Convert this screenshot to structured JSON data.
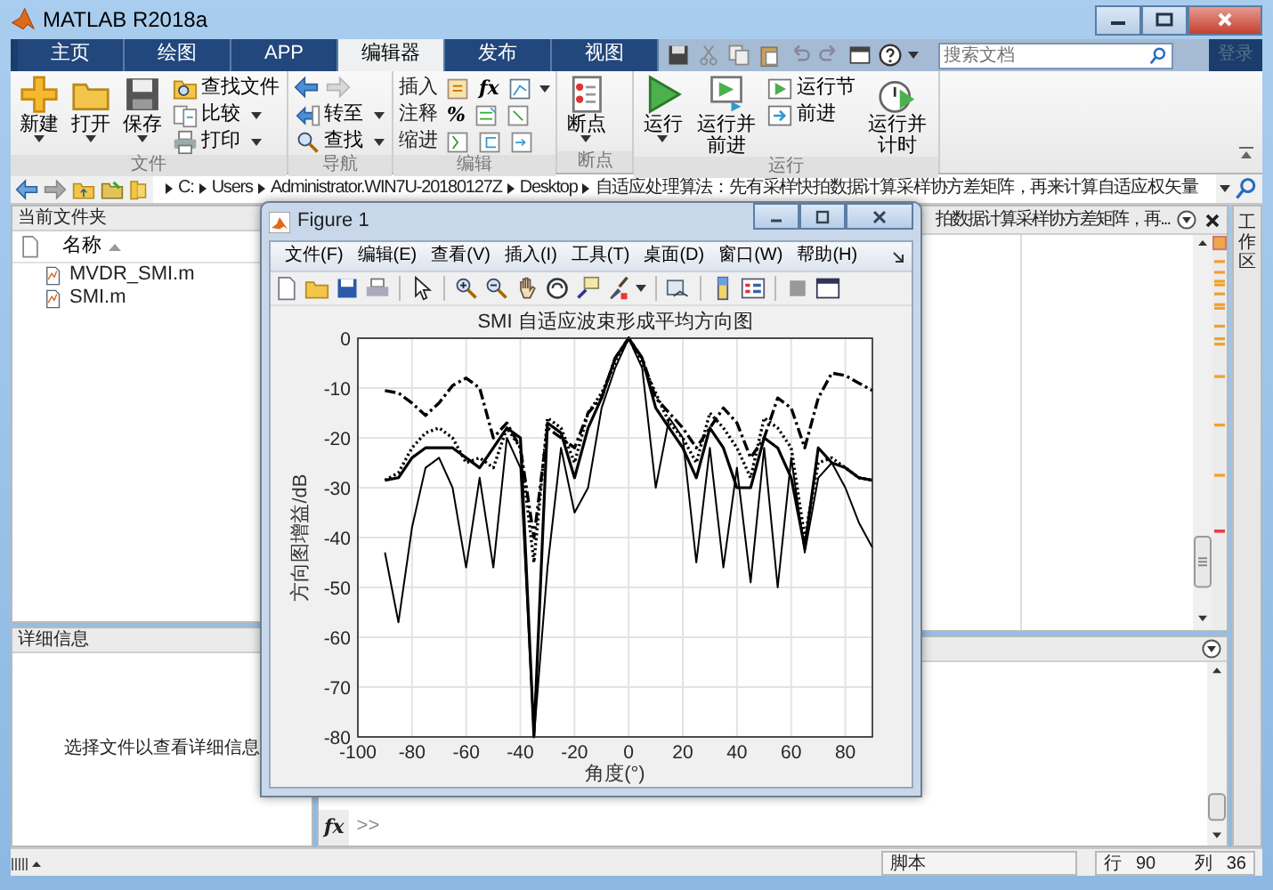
{
  "window": {
    "title": "MATLAB R2018a"
  },
  "tabs": [
    {
      "label": "主页",
      "selected": false
    },
    {
      "label": "绘图",
      "selected": false
    },
    {
      "label": "APP",
      "selected": false
    },
    {
      "label": "编辑器",
      "selected": true
    },
    {
      "label": "发布",
      "selected": false
    },
    {
      "label": "视图",
      "selected": false
    }
  ],
  "search": {
    "placeholder": "搜索文档"
  },
  "sign_in": "登录",
  "ribbon_groups": [
    {
      "label": "文件",
      "items": [
        {
          "kind": "large",
          "label": "新建",
          "dropdown": true
        },
        {
          "kind": "large",
          "label": "打开",
          "dropdown": true
        },
        {
          "kind": "large",
          "label": "保存",
          "dropdown": true
        },
        {
          "kind": "stack",
          "entries": [
            {
              "label": "查找文件",
              "dropdown": false
            },
            {
              "label": "比较",
              "dropdown": true
            },
            {
              "label": "打印",
              "dropdown": true
            }
          ]
        }
      ]
    },
    {
      "label": "导航",
      "items": [
        {
          "kind": "stack",
          "entries": [
            {
              "kind": "history",
              "forward_enabled": false
            },
            {
              "label": "转至",
              "dropdown": true
            },
            {
              "label": "查找",
              "dropdown": true
            }
          ]
        }
      ]
    },
    {
      "label": "编辑",
      "items": [
        {
          "kind": "tool_rows",
          "rows": [
            {
              "label": "插入",
              "tools": [
                {
                  "kind": "icon"
                },
                {
                  "kind": "glyph",
                  "text": "fx"
                },
                {
                  "kind": "icon"
                }
              ],
              "dropdown": true
            },
            {
              "label": "注释",
              "tools": [
                {
                  "kind": "glyph",
                  "text": "%"
                },
                {
                  "kind": "icon"
                },
                {
                  "kind": "icon"
                }
              ],
              "dropdown": false
            },
            {
              "label": "缩进",
              "tools": [
                {
                  "kind": "icon"
                },
                {
                  "kind": "icon"
                },
                {
                  "kind": "icon"
                }
              ],
              "dropdown": false
            }
          ]
        }
      ]
    },
    {
      "label": "断点",
      "items": [
        {
          "kind": "large",
          "label": "断点",
          "dropdown": true
        }
      ]
    },
    {
      "label": "运行",
      "items": [
        {
          "kind": "large",
          "label": "运行",
          "dropdown": true
        },
        {
          "kind": "large",
          "label": "运行并前进",
          "dropdown": false
        },
        {
          "kind": "stack",
          "entries": [
            {
              "label": "运行节",
              "dropdown": false
            },
            {
              "label": "前进",
              "dropdown": false
            }
          ]
        },
        {
          "kind": "large",
          "label": "运行并计时",
          "dropdown": false
        }
      ]
    }
  ],
  "address_bar": {
    "crumbs": [
      "C:",
      "Users",
      "Administrator.WIN7U-20180127Z",
      "Desktop",
      "自适应处理算法：先有采样快拍数据计算采样协方差矩阵，再来计算自适应权矢量"
    ]
  },
  "current_folder": {
    "title": "当前文件夹",
    "column": "名称",
    "files": [
      "MVDR_SMI.m",
      "SMI.m"
    ]
  },
  "details": {
    "title": "详细信息",
    "message": "选择文件以查看详细信息"
  },
  "editor": {
    "title": "拍数据计算采样协方差矩阵，再..."
  },
  "command_window": {
    "fx": "fx",
    "prompt": ">>"
  },
  "workspace_tab": "工作区",
  "status_bar": {
    "mode": "脚本",
    "line_label": "行",
    "line": "90",
    "column_label": "列",
    "column": "36"
  },
  "figure": {
    "title": "Figure 1",
    "menu": [
      "文件(F)",
      "编辑(E)",
      "查看(V)",
      "插入(I)",
      "工具(T)",
      "桌面(D)",
      "窗口(W)",
      "帮助(H)"
    ],
    "chart_data": {
      "type": "line",
      "grid": true,
      "title": "SMI 自适应波束形成平均方向图",
      "xlabel": "角度(°)",
      "ylabel": "方向图增益/dB",
      "xlim": [
        -100,
        90
      ],
      "ylim": [
        -80,
        0
      ],
      "xticks": [
        -100,
        -80,
        -60,
        -40,
        -20,
        0,
        20,
        40,
        60,
        80
      ],
      "yticks": [
        -80,
        -70,
        -60,
        -50,
        -40,
        -30,
        -20,
        -10,
        0
      ],
      "x": [
        -90,
        -85,
        -80,
        -75,
        -70,
        -65,
        -60,
        -55,
        -50,
        -45,
        -40,
        -35,
        -30,
        -25,
        -20,
        -15,
        -10,
        -5,
        0,
        5,
        10,
        15,
        20,
        25,
        30,
        35,
        40,
        45,
        50,
        55,
        60,
        65,
        70,
        75,
        80,
        85,
        90
      ],
      "series": [
        {
          "line_style": "dashdot",
          "color": "#000000",
          "values": [
            -10.5,
            -11,
            -13,
            -15.5,
            -13,
            -9.5,
            -8,
            -10,
            -20,
            -17,
            -22,
            -40,
            -18,
            -20,
            -22,
            -15,
            -12,
            -4,
            0,
            -4,
            -12,
            -15,
            -18,
            -22,
            -18,
            -14,
            -17,
            -24,
            -20,
            -12,
            -14,
            -22,
            -12,
            -7,
            -7.5,
            -9,
            -10.5
          ]
        },
        {
          "line_style": "dotted",
          "color": "#000000",
          "values": [
            -28.5,
            -27,
            -22,
            -19,
            -18,
            -20,
            -25,
            -24,
            -26,
            -18,
            -22,
            -45,
            -16,
            -18,
            -25,
            -15,
            -11,
            -5,
            0,
            -5,
            -11,
            -17,
            -20,
            -25,
            -15,
            -18,
            -22,
            -28,
            -16,
            -18,
            -22,
            -40,
            -25,
            -24,
            -26,
            -28,
            -28.5
          ]
        },
        {
          "line_style": "solid",
          "color": "#000000",
          "values": [
            -28.5,
            -28,
            -24,
            -22,
            -22,
            -22,
            -24,
            -26,
            -22,
            -18,
            -20,
            -80,
            -17,
            -19,
            -28,
            -18,
            -12,
            -4,
            0,
            -4,
            -14,
            -18,
            -22,
            -28,
            -18,
            -22,
            -30,
            -30,
            -20,
            -22,
            -28,
            -42,
            -22,
            -25,
            -26,
            -28,
            -28.5
          ]
        },
        {
          "line_style": "solid",
          "color": "#000000",
          "values": [
            -43,
            -57,
            -38,
            -26,
            -24,
            -30,
            -46,
            -28,
            -46,
            -20,
            -26,
            -80,
            -46,
            -22,
            -35,
            -30,
            -14,
            -6,
            0,
            -6,
            -30,
            -16,
            -20,
            -45,
            -22,
            -46,
            -26,
            -49,
            -22,
            -50,
            -24,
            -43,
            -28,
            -25,
            -30,
            -37,
            -42
          ]
        }
      ]
    }
  }
}
